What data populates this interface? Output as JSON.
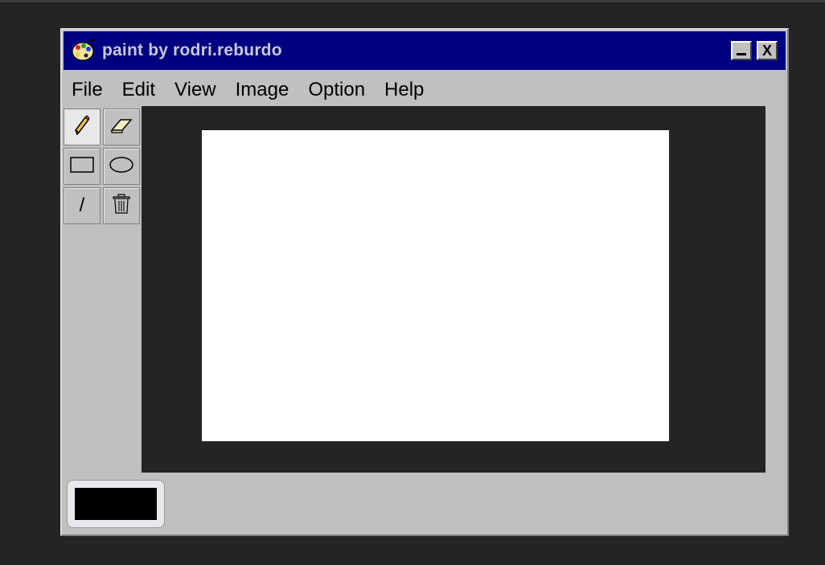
{
  "window": {
    "title": "paint by rodri.reburdo",
    "app_icon": "palette-icon",
    "minimize_icon": "minimize-icon",
    "close_label": "X"
  },
  "menu": {
    "items": [
      {
        "label": "File"
      },
      {
        "label": "Edit"
      },
      {
        "label": "View"
      },
      {
        "label": "Image"
      },
      {
        "label": "Option"
      },
      {
        "label": "Help"
      }
    ]
  },
  "tools": [
    {
      "name": "pencil-tool",
      "icon": "pencil-icon",
      "selected": true
    },
    {
      "name": "eraser-tool",
      "icon": "eraser-icon",
      "selected": false
    },
    {
      "name": "rectangle-tool",
      "icon": "rectangle-icon",
      "selected": false
    },
    {
      "name": "ellipse-tool",
      "icon": "ellipse-icon",
      "selected": false
    },
    {
      "name": "line-tool",
      "icon": "line-icon",
      "label": "/",
      "selected": false
    },
    {
      "name": "clear-tool",
      "icon": "trash-icon",
      "selected": false
    }
  ],
  "colors": {
    "titlebar": "#000080",
    "window": "#c0c0c0",
    "canvas": "#ffffff",
    "current_color": "#000000"
  }
}
